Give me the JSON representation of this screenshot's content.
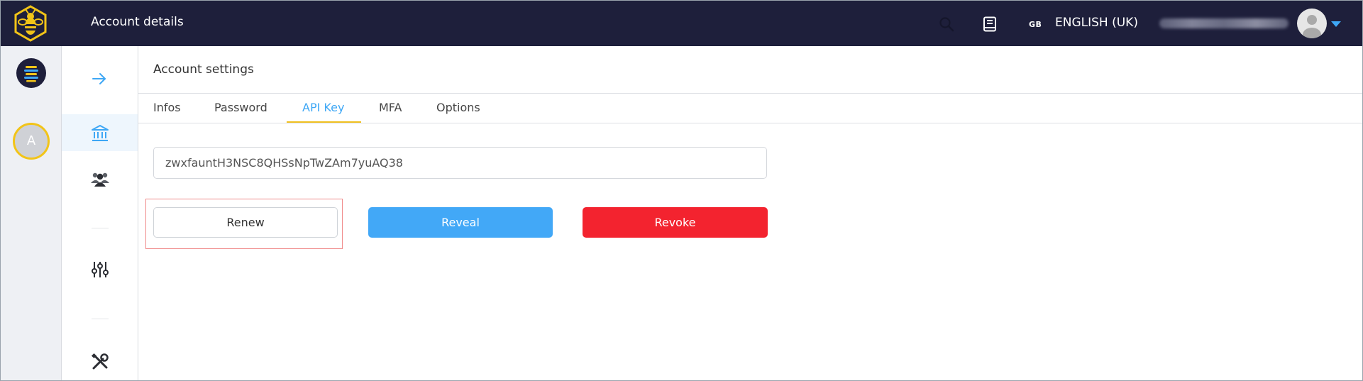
{
  "header": {
    "page_title": "Account details",
    "lang_code": "GB",
    "lang_name": "ENGLISH (UK)"
  },
  "rail": {
    "avatar_letter": "A"
  },
  "main": {
    "settings_title": "Account settings",
    "tabs": [
      {
        "label": "Infos"
      },
      {
        "label": "Password"
      },
      {
        "label": "API Key"
      },
      {
        "label": "MFA"
      },
      {
        "label": "Options"
      }
    ],
    "active_tab": "API Key",
    "api_key_value": "zwxfauntH3NSC8QHSsNpTwZAm7yuAQ38",
    "buttons": {
      "renew": "Renew",
      "reveal": "Reveal",
      "revoke": "Revoke"
    }
  },
  "colors": {
    "topbar": "#1e1f3b",
    "accent": "#3ea7f5",
    "tab_underline": "#f0c020",
    "reveal": "#42a8f7",
    "revoke": "#f3232f",
    "highlight_outline": "#f08b8b"
  },
  "icons": {
    "logo": "bee-logo-icon",
    "search": "search-icon",
    "docs": "book-icon",
    "user": "user-avatar-icon",
    "caret": "caret-down-icon",
    "rail_logo": "hive-logo-icon",
    "nav_expand": "arrow-right-icon",
    "nav_bank": "bank-icon",
    "nav_users": "users-icon",
    "nav_settings": "sliders-icon",
    "nav_tools": "tools-icon"
  }
}
